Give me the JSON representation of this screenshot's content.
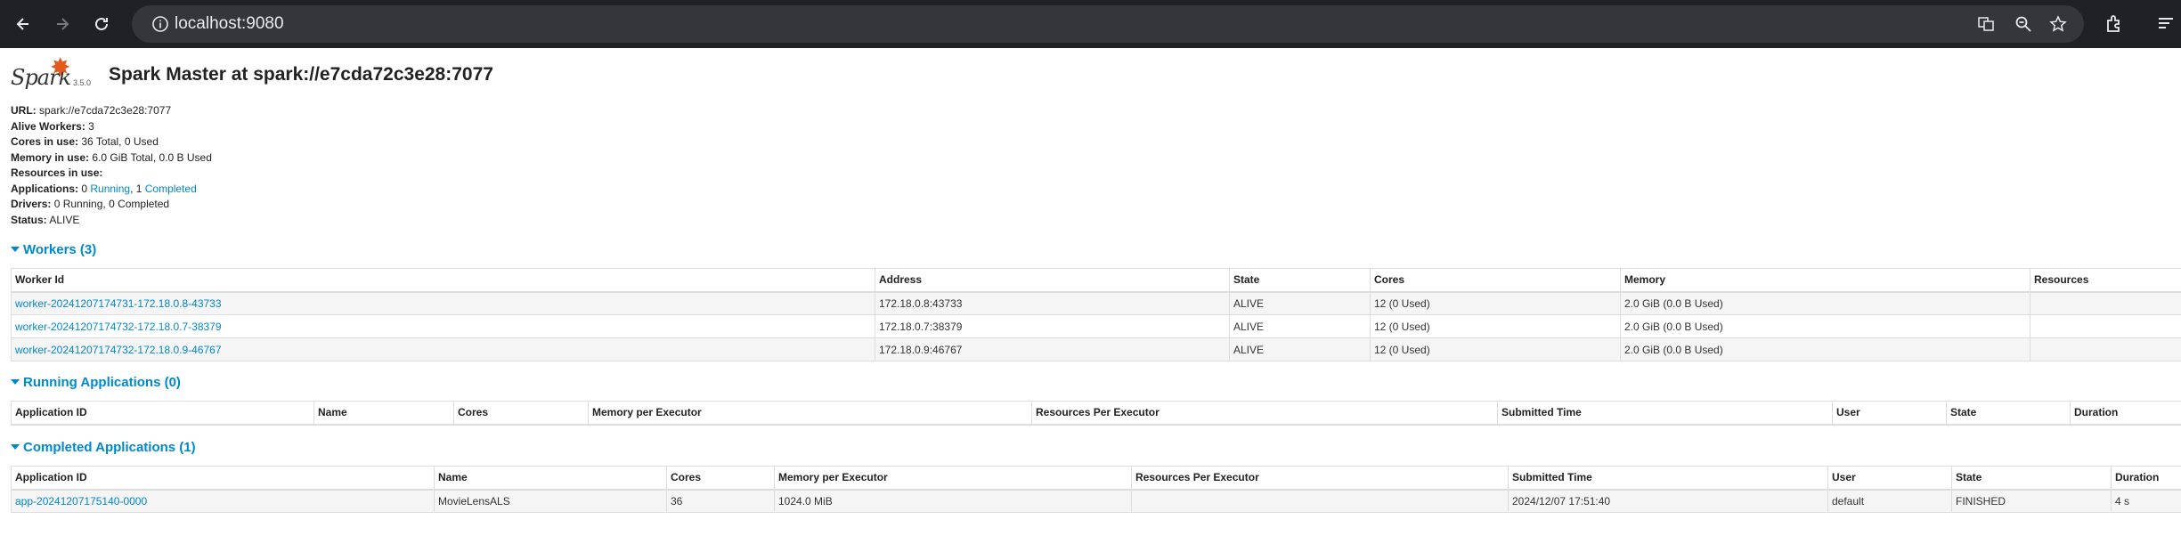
{
  "browser": {
    "url": "localhost:9080"
  },
  "header": {
    "logo_text": "Spark",
    "logo_sup": "APACHE",
    "version": "3.5.0",
    "title": "Spark Master at spark://e7cda72c3e28:7077"
  },
  "summary": [
    {
      "key": "URL:",
      "value": " spark://e7cda72c3e28:7077"
    },
    {
      "key": "Alive Workers:",
      "value": " 3"
    },
    {
      "key": "Cores in use:",
      "value": " 36 Total, 0 Used"
    },
    {
      "key": "Memory in use:",
      "value": " 6.0 GiB Total, 0.0 B Used"
    },
    {
      "key": "Resources in use:",
      "value": ""
    },
    {
      "key": "Drivers:",
      "value": " 0 Running, 0 Completed"
    },
    {
      "key": "Status:",
      "value": " ALIVE"
    }
  ],
  "applications_summary": {
    "key": "Applications:",
    "running_count": " 0 ",
    "running_label": "Running",
    "sep": ", 1 ",
    "completed_label": "Completed"
  },
  "workers": {
    "heading": "Workers (3)",
    "columns": [
      "Worker Id",
      "Address",
      "State",
      "Cores",
      "Memory",
      "Resources"
    ],
    "rows": [
      [
        "worker-20241207174731-172.18.0.8-43733",
        "172.18.0.8:43733",
        "ALIVE",
        "12 (0 Used)",
        "2.0 GiB (0.0 B Used)",
        ""
      ],
      [
        "worker-20241207174732-172.18.0.7-38379",
        "172.18.0.7:38379",
        "ALIVE",
        "12 (0 Used)",
        "2.0 GiB (0.0 B Used)",
        ""
      ],
      [
        "worker-20241207174732-172.18.0.9-46767",
        "172.18.0.9:46767",
        "ALIVE",
        "12 (0 Used)",
        "2.0 GiB (0.0 B Used)",
        ""
      ]
    ]
  },
  "running_apps": {
    "heading": "Running Applications (0)",
    "columns": [
      "Application ID",
      "Name",
      "Cores",
      "Memory per Executor",
      "Resources Per Executor",
      "Submitted Time",
      "User",
      "State",
      "Duration"
    ]
  },
  "completed_apps": {
    "heading": "Completed Applications (1)",
    "columns": [
      "Application ID",
      "Name",
      "Cores",
      "Memory per Executor",
      "Resources Per Executor",
      "Submitted Time",
      "User",
      "State",
      "Duration"
    ],
    "rows": [
      [
        "app-20241207175140-0000",
        "MovieLensALS",
        "36",
        "1024.0 MiB",
        "",
        "2024/12/07 17:51:40",
        "default",
        "FINISHED",
        "4 s"
      ]
    ]
  }
}
